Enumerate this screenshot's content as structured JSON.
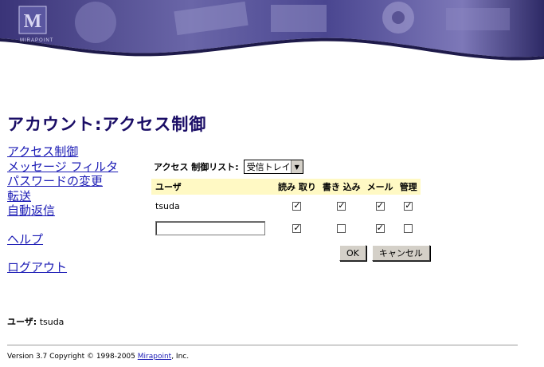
{
  "banner": {
    "logo_letter": "M",
    "logo_text": "MIRAPOINT"
  },
  "page_title": "アカウント:アクセス制御",
  "nav": {
    "items": [
      "アクセス制御",
      "メッセージ フィルタ",
      "パスワードの変更",
      "転送",
      "自動返信"
    ],
    "help": "ヘルプ",
    "logout": "ログアウト"
  },
  "acl": {
    "list_label": "アクセス 制御リスト:",
    "folder_select": "受信トレイ",
    "columns": {
      "user": "ユーザ",
      "read": "読み 取り",
      "write": "書き 込み",
      "mail": "メール",
      "admin": "管理"
    },
    "rows": [
      {
        "user": "tsuda",
        "read": true,
        "write": true,
        "mail": true,
        "admin": true
      }
    ],
    "new_row": {
      "user_value": "",
      "read": true,
      "write": false,
      "mail": true,
      "admin": false
    },
    "ok_label": "OK",
    "cancel_label": "キャンセル"
  },
  "user_info": {
    "label": "ユーザ:",
    "value": "tsuda"
  },
  "footer": {
    "prefix": "Version 3.7 Copyright © 1998-2005 ",
    "link": "Mirapoint",
    "suffix": ", Inc."
  }
}
